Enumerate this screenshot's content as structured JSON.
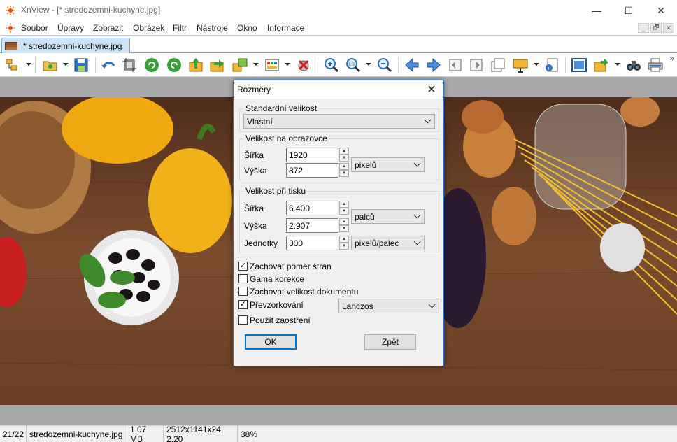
{
  "window": {
    "title": "XnView - [* stredozemni-kuchyne.jpg]",
    "minimize": "—",
    "maximize": "☐",
    "close": "✕"
  },
  "menu": {
    "items": [
      "Soubor",
      "Úpravy",
      "Zobrazit",
      "Obrázek",
      "Filtr",
      "Nástroje",
      "Okno",
      "Informace"
    ],
    "mdi_minimize": "_",
    "mdi_restore": "🗗",
    "mdi_close": "✕"
  },
  "tab": {
    "label": "* stredozemni-kuchyne.jpg"
  },
  "toolbar": {
    "more": "»",
    "icons": [
      "browser-icon",
      "open-icon",
      "save-icon",
      "undo-icon",
      "crop-icon",
      "rotate-left-icon",
      "rotate-right-icon",
      "move-up-icon",
      "move-next-icon",
      "convert-icon",
      "palette-icon",
      "red-eye-icon",
      "zoom-in-icon",
      "zoom-fit-icon",
      "zoom-out-icon",
      "previous-icon",
      "next-icon",
      "first-page-icon",
      "next-page-icon",
      "page-icon",
      "slideshow-icon",
      "info-icon",
      "fullscreen-icon",
      "export-icon",
      "binoculars-icon",
      "print-icon"
    ]
  },
  "dialog": {
    "title": "Rozměry",
    "standard_size": {
      "label": "Standardní velikost",
      "value": "Vlastní"
    },
    "screen_size": {
      "label": "Velikost na obrazovce",
      "width_label": "Šířka",
      "width_value": "1920",
      "height_label": "Výška",
      "height_value": "872",
      "unit": "pixelů"
    },
    "print_size": {
      "label": "Velikost při tisku",
      "width_label": "Šířka",
      "width_value": "6.400",
      "height_label": "Výška",
      "height_value": "2.907",
      "unit": "palců",
      "units_label": "Jednotky",
      "units_value": "300",
      "units_unit": "pixelů/palec"
    },
    "options": {
      "keep_ratio": {
        "label": "Zachovat poměr stran",
        "checked": true
      },
      "gamma": {
        "label": "Gama korekce",
        "checked": false
      },
      "keep_doc_size": {
        "label": "Zachovat velikost dokumentu",
        "checked": false
      },
      "resample": {
        "label": "Převzorkování",
        "checked": true,
        "method": "Lanczos"
      },
      "sharpen": {
        "label": "Použít zaostření",
        "checked": false
      }
    },
    "ok": "OK",
    "back": "Zpět"
  },
  "status": {
    "index": "21/22",
    "filename": "stredozemni-kuchyne.jpg",
    "filesize": "1.07 MB",
    "dimensions": "2512x1141x24, 2.20",
    "zoom": "38%"
  }
}
